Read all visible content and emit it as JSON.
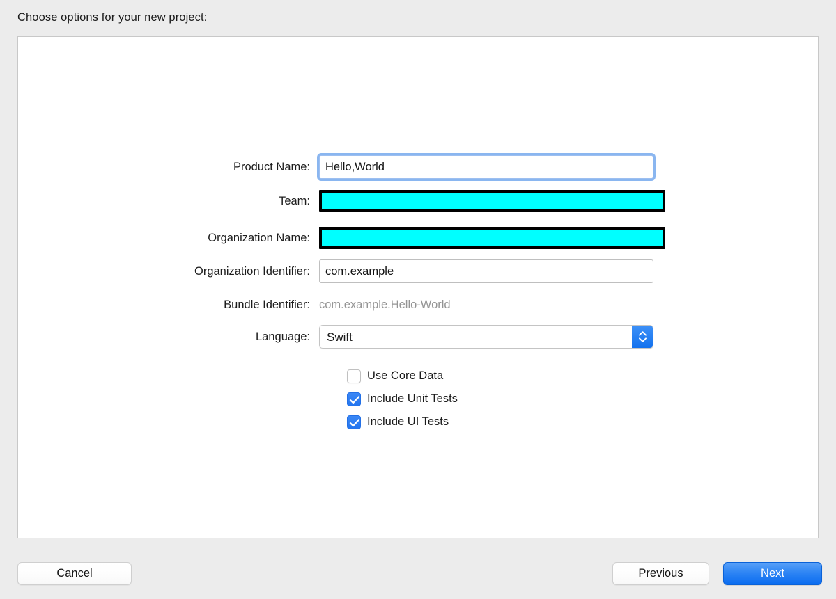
{
  "prompt": "Choose options for your new project:",
  "form": {
    "fields": [
      {
        "label": "Product Name:",
        "value": "Hello,World",
        "placeholder": "",
        "kind": "text-focused"
      },
      {
        "label": "Team:",
        "value": "",
        "placeholder": "",
        "kind": "highlight"
      },
      {
        "label": "Organization Name:",
        "value": "",
        "placeholder": "",
        "kind": "highlight"
      },
      {
        "label": "Organization Identifier:",
        "value": "com.example",
        "placeholder": "",
        "kind": "text"
      },
      {
        "label": "Bundle Identifier:",
        "value": "com.example.Hello-World",
        "placeholder": "",
        "kind": "static"
      },
      {
        "label": "Language:",
        "value": "Swift",
        "placeholder": "",
        "kind": "popup"
      }
    ]
  },
  "checkboxes": [
    {
      "label": "Use Core Data",
      "checked": false
    },
    {
      "label": "Include Unit Tests",
      "checked": true
    },
    {
      "label": "Include UI Tests",
      "checked": true
    }
  ],
  "footer": {
    "cancel_label": "Cancel",
    "previous_label": "Previous",
    "next_label": "Next"
  },
  "colors": {
    "window_background": "#ececec",
    "panel_background": "#ffffff",
    "panel_border": "#c8c8c8",
    "accent_blue": "#0a6cf0",
    "focus_ring": "#8ab6f0",
    "highlight_fill": "#00ffff",
    "highlight_border": "#000000",
    "static_text": "#949494",
    "label_text": "#1d1d1d"
  },
  "icons": {
    "stepper_up": "chevron-up-icon",
    "stepper_down": "chevron-down-icon",
    "checkmark": "checkmark-icon"
  }
}
